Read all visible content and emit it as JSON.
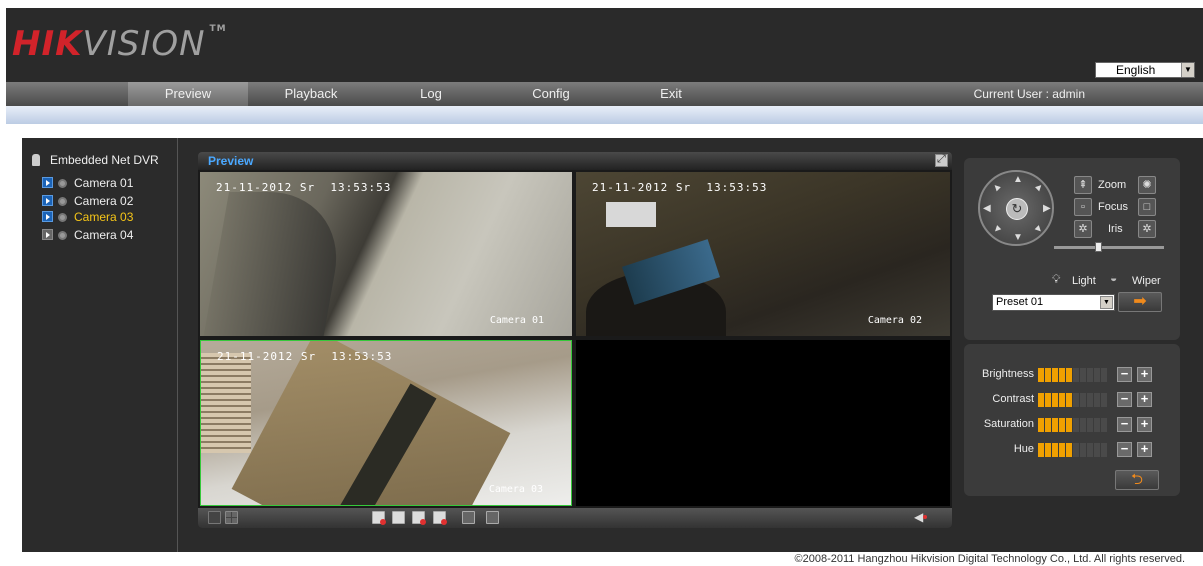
{
  "header": {
    "logo_primary": "HIK",
    "logo_secondary": "VISION",
    "logo_tm": "TM",
    "language": "English"
  },
  "nav": {
    "items": [
      "Preview",
      "Playback",
      "Log",
      "Config",
      "Exit"
    ],
    "active": "Preview",
    "current_user": "Current User : admin"
  },
  "tree": {
    "root": "Embedded Net DVR",
    "cameras": [
      {
        "label": "Camera 01",
        "active": false
      },
      {
        "label": "Camera 02",
        "active": false
      },
      {
        "label": "Camera 03",
        "active": true
      },
      {
        "label": "Camera 04",
        "active": false
      }
    ]
  },
  "preview": {
    "title": "Preview",
    "cells": [
      {
        "date": "21-11-2012 Sr  13:53:53",
        "name": "Camera 01"
      },
      {
        "date": "21-11-2012 Sr  13:53:53",
        "name": "Camera 02"
      },
      {
        "date": "21-11-2012 Sr  13:53:53",
        "name": "Camera 03"
      },
      {
        "date": "",
        "name": ""
      }
    ]
  },
  "ptz": {
    "zoom_label": "Zoom",
    "focus_label": "Focus",
    "iris_label": "Iris",
    "light_label": "Light",
    "wiper_label": "Wiper",
    "preset_value": "Preset 01",
    "speed_level": 0.4
  },
  "image_params": [
    {
      "label": "Brightness",
      "level": 5,
      "max": 10
    },
    {
      "label": "Contrast",
      "level": 5,
      "max": 10
    },
    {
      "label": "Saturation",
      "level": 5,
      "max": 10
    },
    {
      "label": "Hue",
      "level": 5,
      "max": 10
    }
  ],
  "footer": {
    "copyright": "©2008-2011 Hangzhou Hikvision Digital Technology Co., Ltd. All rights reserved."
  },
  "colors": {
    "brand_red": "#d2232a",
    "accent_orange": "#f0a000",
    "active_camera": "#f5c518",
    "title_blue": "#4aa8ff"
  }
}
